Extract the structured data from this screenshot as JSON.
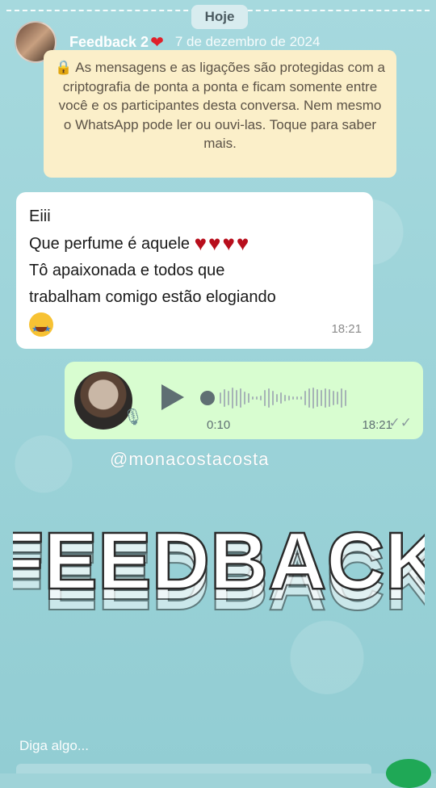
{
  "story": {
    "today_label": "Hoje",
    "username": "Feedback 2",
    "heart": "❤",
    "date": "7 de dezembro de 2024"
  },
  "notice": {
    "lock": "🔒",
    "text": "As mensagens e as ligações são protegidas com a criptografia de ponta a ponta e ficam somente entre você e os participantes desta conversa. Nem mesmo o WhatsApp pode ler ou ouvi-las. Toque para saber mais."
  },
  "incoming": {
    "line1": "Eiii",
    "line2": "Que perfume é aquele",
    "hearts": "♥♥♥♥",
    "line3": "Tô apaixonada e todos que",
    "line4": "trabalham comigo estão elogiando",
    "time": "18:21"
  },
  "outgoing": {
    "duration": "0:10",
    "time": "18:21",
    "ticks": "✓✓",
    "progress": 0
  },
  "overlay": {
    "handle": "@monacostacosta",
    "title": "FEEDBACK"
  },
  "reply": {
    "placeholder": "Diga algo..."
  }
}
